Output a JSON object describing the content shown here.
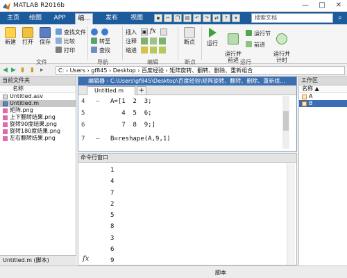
{
  "window": {
    "title": "MATLAB R2016b",
    "min": "—",
    "max": "□",
    "close": "✕"
  },
  "tabs": [
    {
      "label": "主页"
    },
    {
      "label": "绘图"
    },
    {
      "label": "APP"
    },
    {
      "label": "编..."
    },
    {
      "label": "发布"
    },
    {
      "label": "视图"
    }
  ],
  "search": {
    "placeholder": "搜索文档"
  },
  "ribbon": {
    "file": {
      "new": "新建",
      "open": "打开",
      "save": "保存",
      "find_files": "查找文件",
      "compare": "比较",
      "print": "打印",
      "group": "文件"
    },
    "navigate": {
      "goto": "转至",
      "find": "查找",
      "group": "导航"
    },
    "edit": {
      "insert": "插入",
      "comment": "注释",
      "indent": "缩进",
      "group": "编辑"
    },
    "breakpoints": {
      "label": "断点",
      "group": "断点"
    },
    "run": {
      "run": "运行",
      "run_advance": "运行并\n前进",
      "run_section": "运行节",
      "advance": "前进",
      "run_time": "运行并\n计时",
      "group": "运行"
    }
  },
  "address": {
    "path": "C: › Users › gf845 › Desktop › 百度经验 › 矩阵旋转、翻转、删除、重新组合"
  },
  "file_panel": {
    "title": "当前文件夹",
    "column": "名称",
    "items": [
      {
        "name": "Untitled.asv",
        "selected": false
      },
      {
        "name": "Untitled.m",
        "selected": true
      },
      {
        "name": "矩阵.png",
        "selected": false
      },
      {
        "name": "上下翻转结果.png",
        "selected": false
      },
      {
        "name": "旋转90度结果.png",
        "selected": false
      },
      {
        "name": "旋转180度结果.png",
        "selected": false
      },
      {
        "name": "左右翻转结果.png",
        "selected": false
      }
    ],
    "footer": "Untitled.m (脚本)"
  },
  "editor": {
    "header": "编辑器 - C:\\Users\\gf845\\Desktop\\百度经验\\矩阵旋转、翻转、删除、重新组...",
    "tab": "Untitled.m",
    "plus": "+",
    "lines": [
      {
        "num": "4",
        "dash": "—",
        "code": "A=[1  2  3;"
      },
      {
        "num": "5",
        "dash": "",
        "code": "   4  5  6;"
      },
      {
        "num": "6",
        "dash": "",
        "code": "   7  8  9;]"
      },
      {
        "num": "7",
        "dash": "—",
        "code": "B=reshape(A,9,1)"
      }
    ]
  },
  "command_window": {
    "title": "命令行窗口",
    "output": [
      "1",
      "4",
      "7",
      "2",
      "5",
      "8",
      "3",
      "6",
      "9"
    ],
    "prompt": "fx"
  },
  "workspace": {
    "title": "工作区",
    "column": "名称 ▲",
    "items": [
      {
        "name": "A",
        "selected": false
      },
      {
        "name": "B",
        "selected": true
      }
    ]
  },
  "statusbar": {
    "text": "脚本"
  }
}
